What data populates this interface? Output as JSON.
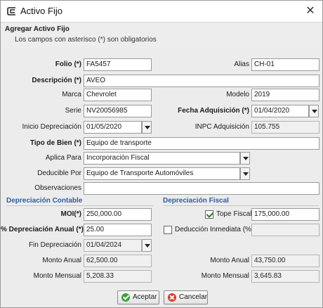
{
  "window": {
    "title": "Activo Fijo",
    "icon": "app-c-icon",
    "close_icon": "close-icon"
  },
  "header": {
    "title": "Agregar Activo Fijo",
    "subtitle": "Los campos con asterisco (*) son obligatorios"
  },
  "form": {
    "folio": {
      "label": "Folio (*)",
      "value": "FA5457"
    },
    "alias": {
      "label": "Alias",
      "value": "CH-01"
    },
    "descripcion": {
      "label": "Descripción (*)",
      "value": "AVEO"
    },
    "marca": {
      "label": "Marca",
      "value": "Chevrolet"
    },
    "modelo": {
      "label": "Modelo",
      "value": "2019"
    },
    "serie": {
      "label": "Serie",
      "value": "NV20056985"
    },
    "fecha_adquisicion": {
      "label": "Fecha Adquisición (*)",
      "value": "01/04/2020"
    },
    "inicio_depreciacion": {
      "label": "Inicio Depreciación",
      "value": "01/05/2020"
    },
    "inpc_adquisicion": {
      "label": "INPC Adquisición",
      "value": "105.755"
    },
    "tipo_bien": {
      "label": "Tipo de Bien (*)",
      "value": "Equipo de transporte"
    },
    "aplica_para": {
      "label": "Aplica Para",
      "value": "Incorporación Fiscal"
    },
    "deducible_por": {
      "label": "Deducible Por",
      "value": "Equipo de Transporte Automóviles"
    },
    "observaciones": {
      "label": "Observaciones",
      "value": ""
    }
  },
  "depreciacion_contable": {
    "title": "Depreciación Contable",
    "moi": {
      "label": "MOI(*)",
      "value": "250,000.00"
    },
    "porcentaje": {
      "label": "% Depreciación Anual (*)",
      "value": "25.00"
    },
    "fin": {
      "label": "Fin Depreciación",
      "value": "01/04/2024"
    },
    "monto_anual": {
      "label": "Monto Anual",
      "value": "62,500.00"
    },
    "monto_mensual": {
      "label": "Monto Mensual",
      "value": "5,208.33"
    }
  },
  "depreciacion_fiscal": {
    "title": "Depreciación Fiscal",
    "tope_fiscal": {
      "label": "Tope Fiscal",
      "value": "175,000.00",
      "checked": true
    },
    "deduccion_inmediata": {
      "label": "Deducción Inmediata (%)",
      "value": "",
      "checked": false
    },
    "monto_anual": {
      "label": "Monto Anual",
      "value": "43,750.00"
    },
    "monto_mensual": {
      "label": "Monto Mensual",
      "value": "3,645.83"
    }
  },
  "buttons": {
    "accept": "Aceptar",
    "cancel": "Cancelar"
  },
  "colors": {
    "section_title": "#2f5e9e",
    "accept_icon": "#3aa43a",
    "cancel_icon": "#d63a2a"
  }
}
